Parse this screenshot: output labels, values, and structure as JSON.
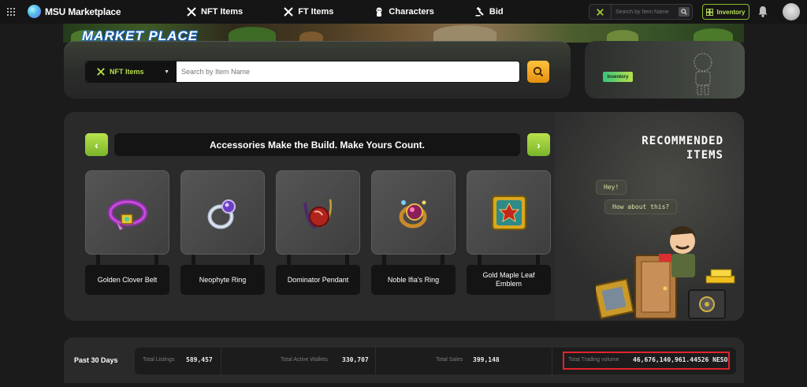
{
  "nav": {
    "brand": "MSU Marketplace",
    "links": [
      {
        "label": "NFT Items",
        "icon": "crossed-swords-icon"
      },
      {
        "label": "FT Items",
        "icon": "crossed-swords-icon"
      },
      {
        "label": "Characters",
        "icon": "character-icon"
      },
      {
        "label": "Bid",
        "icon": "bid-icon"
      }
    ],
    "search_placeholder": "Search by Item Name",
    "inventory_label": "Inventory"
  },
  "banner": {
    "title": "MARKET PLACE"
  },
  "search": {
    "category": "NFT Items",
    "placeholder": "Search by Item Name"
  },
  "inventory_panel": {
    "chip_label": "Inventory"
  },
  "recommended": {
    "headline": "Accessories Make the Build. Make Yours Count.",
    "title_line1": "RECOMMENDED",
    "title_line2": "ITEMS",
    "bubble1": "Hey!",
    "bubble2": "How about this?",
    "items": [
      {
        "name": "Golden Clover Belt",
        "icon": "belt-icon"
      },
      {
        "name": "Neophyte Ring",
        "icon": "ring-icon"
      },
      {
        "name": "Dominator Pendant",
        "icon": "pendant-icon"
      },
      {
        "name": "Noble Ifia's Ring",
        "icon": "ring-icon"
      },
      {
        "name": "Gold Maple Leaf Emblem",
        "icon": "emblem-icon"
      }
    ]
  },
  "stats": {
    "period": "Past 30 Days",
    "total_listings_label": "Total Listings",
    "total_listings": "589,457",
    "active_wallets_label": "Total Active Wallets",
    "active_wallets": "330,707",
    "total_sales_label": "Total Sales",
    "total_sales": "399,148",
    "trading_volume_label": "Total Trading volume",
    "trading_volume": "46,676,140,961.44526 NESO"
  },
  "colors": {
    "accent": "#9fd23a",
    "search_button": "#f0a21d",
    "highlight": "#e0242a"
  }
}
